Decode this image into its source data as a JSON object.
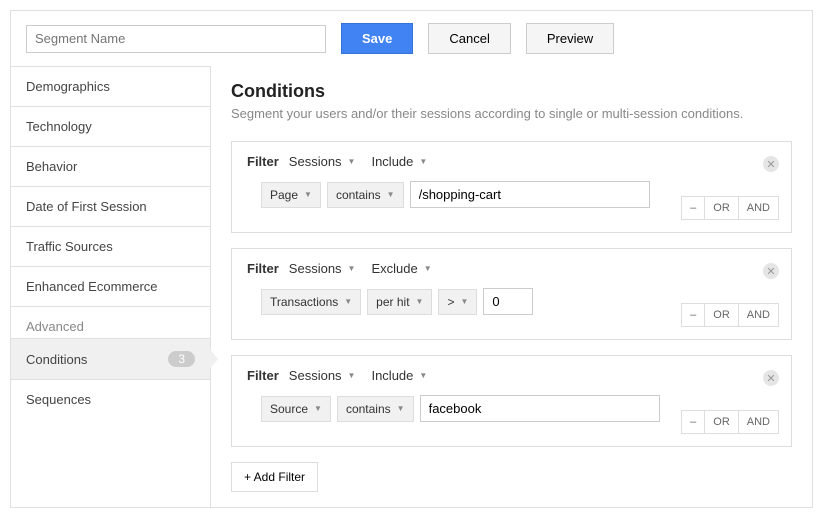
{
  "segment_placeholder": "Segment Name",
  "buttons": {
    "save": "Save",
    "cancel": "Cancel",
    "preview": "Preview"
  },
  "sidebar": {
    "items": [
      "Demographics",
      "Technology",
      "Behavior",
      "Date of First Session",
      "Traffic Sources",
      "Enhanced Ecommerce"
    ],
    "advanced_label": "Advanced",
    "conditions": "Conditions",
    "conditions_count": "3",
    "sequences": "Sequences"
  },
  "content": {
    "title": "Conditions",
    "subtitle": "Segment your users and/or their sessions according to single or multi-session conditions.",
    "filter_label": "Filter",
    "sessions": "Sessions",
    "include": "Include",
    "exclude": "Exclude",
    "add_filter": "+ Add Filter",
    "ops": {
      "minus": "–",
      "or": "OR",
      "and": "AND"
    },
    "filters": [
      {
        "scope": "Sessions",
        "mode": "Include",
        "dim": "Page",
        "match": "contains",
        "value": "/shopping-cart"
      },
      {
        "scope": "Sessions",
        "mode": "Exclude",
        "dim": "Transactions",
        "match": "per hit",
        "op": ">",
        "value": "0"
      },
      {
        "scope": "Sessions",
        "mode": "Include",
        "dim": "Source",
        "match": "contains",
        "value": "facebook"
      }
    ]
  }
}
